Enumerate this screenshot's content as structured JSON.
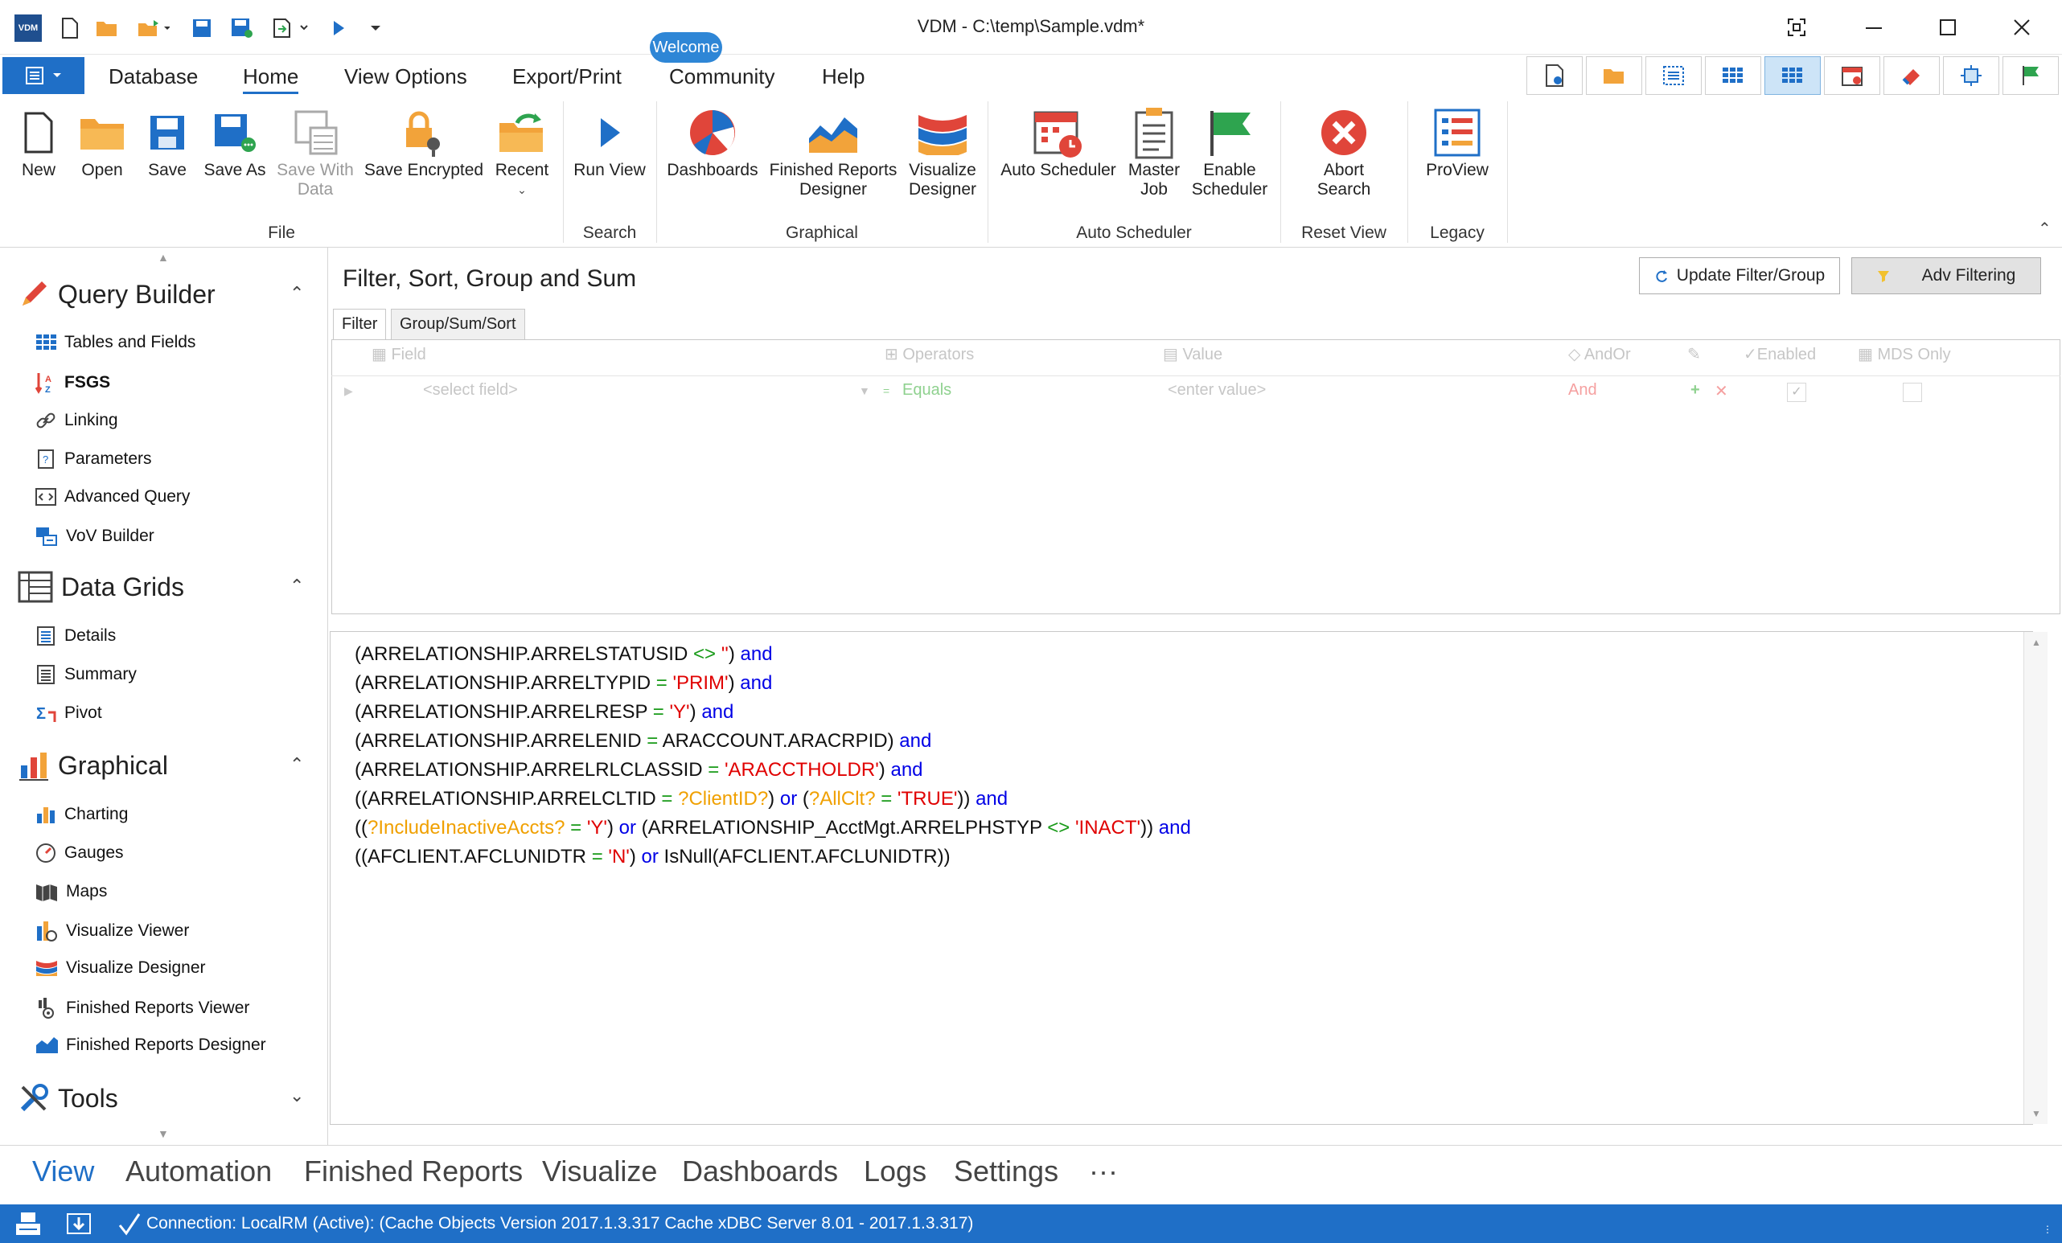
{
  "window": {
    "title": "VDM - C:\\temp\\Sample.vdm*"
  },
  "quick_access": {
    "icons": [
      "vdm-logo-icon",
      "new-file-icon",
      "open-folder-icon",
      "open-recent-icon",
      "save-icon",
      "save-all-icon",
      "export-icon",
      "run-icon",
      "customize-icon"
    ],
    "logo_text": "VDM"
  },
  "menu": {
    "tabs": [
      "Database",
      "Home",
      "View Options",
      "Export/Print",
      "Community",
      "Help"
    ],
    "active": "Home",
    "welcome_badge": "Welcome"
  },
  "ribbon": {
    "file": {
      "group_label": "File",
      "buttons": {
        "new": "New",
        "open": "Open",
        "save": "Save",
        "save_as": "Save As",
        "save_with_data_1": "Save With",
        "save_with_data_2": "Data",
        "save_encrypted": "Save Encrypted",
        "recent": "Recent"
      }
    },
    "search": {
      "group_label": "Search",
      "run_view": "Run View"
    },
    "graphical": {
      "group_label": "Graphical",
      "dashboards": "Dashboards",
      "frd_1": "Finished Reports",
      "frd_2": "Designer",
      "vis_1": "Visualize",
      "vis_2": "Designer"
    },
    "auto_scheduler": {
      "group_label": "Auto Scheduler",
      "auto_scheduler": "Auto Scheduler",
      "master_1": "Master",
      "master_2": "Job",
      "enable_1": "Enable",
      "enable_2": "Scheduler"
    },
    "reset_view": {
      "group_label": "Reset View",
      "abort_1": "Abort",
      "abort_2": "Search"
    },
    "legacy": {
      "group_label": "Legacy",
      "proview": "ProView"
    }
  },
  "leftnav": {
    "query_builder": {
      "title": "Query Builder",
      "items": [
        "Tables and Fields",
        "FSGS",
        "Linking",
        "Parameters",
        "Advanced Query",
        "VoV Builder"
      ]
    },
    "data_grids": {
      "title": "Data Grids",
      "items": [
        "Details",
        "Summary",
        "Pivot"
      ]
    },
    "graphical": {
      "title": "Graphical",
      "items": [
        "Charting",
        "Gauges",
        "Maps",
        "Visualize Viewer",
        "Visualize Designer",
        "Finished Reports Viewer",
        "Finished Reports Designer"
      ]
    },
    "tools": {
      "title": "Tools"
    }
  },
  "panel": {
    "title": "Filter, Sort, Group and Sum",
    "update_button": "Update Filter/Group",
    "adv_button": "Adv Filtering",
    "tabs": [
      "Filter",
      "Group/Sum/Sort"
    ],
    "grid": {
      "headers": {
        "field": "Field",
        "operators": "Operators",
        "value": "Value",
        "andor": "AndOr",
        "enabled": "Enabled",
        "mds": "MDS Only"
      },
      "row": {
        "field": "<select field>",
        "operator": "Equals",
        "value": "<enter value>",
        "andor": "And"
      }
    }
  },
  "code": {
    "lines": [
      [
        [
          "blk",
          "(ARRELATIONSHIP.ARRELSTATUSID "
        ],
        [
          "grn",
          "<>"
        ],
        [
          "blk",
          " "
        ],
        [
          "red",
          "''"
        ],
        [
          "blk",
          ") "
        ],
        [
          "blu",
          "and"
        ]
      ],
      [
        [
          "blk",
          "(ARRELATIONSHIP.ARRELTYPID "
        ],
        [
          "grn",
          "="
        ],
        [
          "blk",
          " "
        ],
        [
          "red",
          "'PRIM'"
        ],
        [
          "blk",
          ") "
        ],
        [
          "blu",
          "and"
        ]
      ],
      [
        [
          "blk",
          "(ARRELATIONSHIP.ARRELRESP "
        ],
        [
          "grn",
          "="
        ],
        [
          "blk",
          " "
        ],
        [
          "red",
          "'Y'"
        ],
        [
          "blk",
          ") "
        ],
        [
          "blu",
          "and"
        ]
      ],
      [
        [
          "blk",
          "(ARRELATIONSHIP.ARRELENID "
        ],
        [
          "grn",
          "="
        ],
        [
          "blk",
          " ARACCOUNT.ARACRPID) "
        ],
        [
          "blu",
          "and"
        ]
      ],
      [
        [
          "blk",
          "(ARRELATIONSHIP.ARRELRLCLASSID "
        ],
        [
          "grn",
          "="
        ],
        [
          "blk",
          " "
        ],
        [
          "red",
          "'ARACCTHOLDR'"
        ],
        [
          "blk",
          ") "
        ],
        [
          "blu",
          "and"
        ]
      ],
      [
        [
          "blk",
          "((ARRELATIONSHIP.ARRELCLTID "
        ],
        [
          "grn",
          "="
        ],
        [
          "blk",
          " "
        ],
        [
          "org",
          "?ClientID?"
        ],
        [
          "blk",
          ") "
        ],
        [
          "blu",
          "or"
        ],
        [
          "blk",
          " ("
        ],
        [
          "org",
          "?AllClt?"
        ],
        [
          "blk",
          " "
        ],
        [
          "grn",
          "="
        ],
        [
          "blk",
          " "
        ],
        [
          "red",
          "'TRUE'"
        ],
        [
          "blk",
          ")) "
        ],
        [
          "blu",
          "and"
        ]
      ],
      [
        [
          "blk",
          "(("
        ],
        [
          "org",
          "?IncludeInactiveAccts?"
        ],
        [
          "blk",
          " "
        ],
        [
          "grn",
          "="
        ],
        [
          "blk",
          " "
        ],
        [
          "red",
          "'Y'"
        ],
        [
          "blk",
          ") "
        ],
        [
          "blu",
          "or"
        ],
        [
          "blk",
          " (ARRELATIONSHIP_AcctMgt.ARRELPHSTYP "
        ],
        [
          "grn",
          "<>"
        ],
        [
          "blk",
          " "
        ],
        [
          "red",
          "'INACT'"
        ],
        [
          "blk",
          ")) "
        ],
        [
          "blu",
          "and"
        ]
      ],
      [
        [
          "blk",
          "((AFCLIENT.AFCLUNIDTR "
        ],
        [
          "grn",
          "="
        ],
        [
          "blk",
          " "
        ],
        [
          "red",
          "'N'"
        ],
        [
          "blk",
          ") "
        ],
        [
          "blu",
          "or"
        ],
        [
          "blk",
          " IsNull(AFCLIENT.AFCLUNIDTR))"
        ]
      ]
    ]
  },
  "bottomnav": {
    "items": [
      "View",
      "Automation",
      "Finished Reports",
      "Visualize",
      "Dashboards",
      "Logs",
      "Settings",
      "···"
    ],
    "active": "View"
  },
  "status": {
    "text": "Connection: LocalRM (Active): (Cache Objects Version 2017.1.3.317 Cache xDBC Server 8.01 - 2017.1.3.317)"
  },
  "colors": {
    "accent": "#1f6fc7",
    "keyword": "#0000e6",
    "string": "#e00000",
    "operator": "#189a18",
    "parameter": "#f0a000"
  }
}
